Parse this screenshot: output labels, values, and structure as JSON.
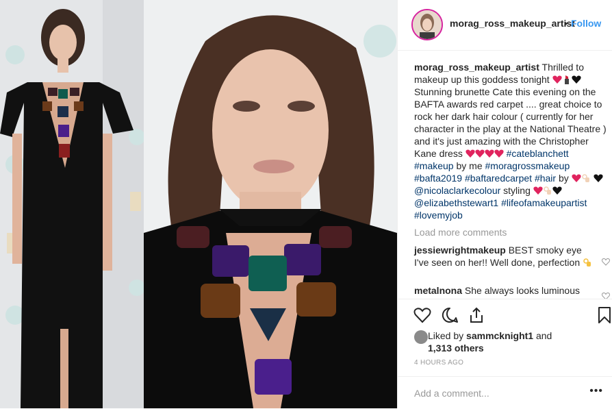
{
  "post": {
    "username": "morag_ross_makeup_artist",
    "dot": "•",
    "follow": "Follow"
  },
  "caption": {
    "user": "morag_ross_makeup_artist",
    "t1": "Thrilled to makeup up this goddess tonight",
    "t2": "Stunning brunette Cate this evening on the BAFTA awards red carpet .... great choice to rock her dark hair colour ( currently for her character in the play at the National Theatre ) and it's just amazing with the Christopher Kane dress",
    "h1": "#cateblanchett",
    "h2": "#makeup",
    "t3": "by me",
    "h3": "#moragrossmakeup",
    "h4": "#bafta2019",
    "h5": "#baftaredcarpet",
    "h6": "#hair",
    "t4": "by",
    "h7": "@nicolaclarkecolour",
    "t5": "styling",
    "h8": "@elizabethstewart1",
    "h9": "#lifeofamakeupartist",
    "h10": "#lovemyjob"
  },
  "load_more": "Load more comments",
  "comments": [
    {
      "user": "jessiewrightmakeup",
      "text": "BEST smoky eye I've seen on her!! Well done, perfection"
    },
    {
      "user": "metalnona",
      "text": "She always looks luminous"
    }
  ],
  "likes": {
    "prefix": "Liked by",
    "user": "sammcknight1",
    "and": "and",
    "others": "1,313 others"
  },
  "time_ago": "4 HOURS AGO",
  "add_comment": "Add a comment...",
  "more_options": "•••",
  "icons": [
    "heart-icon",
    "comment-icon",
    "share-icon",
    "bookmark-icon",
    "options-icon"
  ],
  "colors": {
    "link": "#003569",
    "follow": "#3897f0",
    "muted": "#999999"
  }
}
